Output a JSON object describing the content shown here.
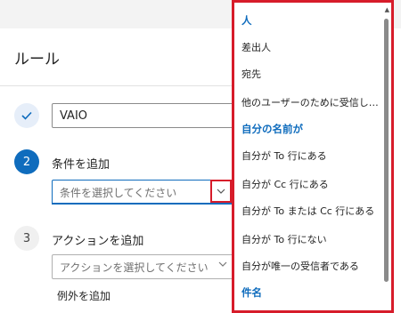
{
  "panel": {
    "title": "ルール",
    "steps": [
      {
        "marker": "",
        "value": "VAIO"
      },
      {
        "marker": "2",
        "label": "条件を追加",
        "placeholder": "条件を選択してください"
      },
      {
        "marker": "3",
        "label": "アクションを追加",
        "placeholder": "アクションを選択してください"
      }
    ],
    "add_exception": "例外を追加"
  },
  "dropdown": {
    "items": [
      {
        "text": "人",
        "group": true
      },
      {
        "text": "差出人",
        "group": false
      },
      {
        "text": "宛先",
        "group": false
      },
      {
        "text": "他のユーザーのために受信した...",
        "group": false
      },
      {
        "text": "自分の名前が",
        "group": true
      },
      {
        "text": "自分が To 行にある",
        "group": false
      },
      {
        "text": "自分が Cc 行にある",
        "group": false
      },
      {
        "text": "自分が To または Cc 行にある",
        "group": false
      },
      {
        "text": "自分が To 行にない",
        "group": false
      },
      {
        "text": "自分が唯一の受信者である",
        "group": false
      },
      {
        "text": "件名",
        "group": true
      }
    ]
  },
  "colors": {
    "accent": "#0f6cbd",
    "highlight": "#d71c2a"
  }
}
